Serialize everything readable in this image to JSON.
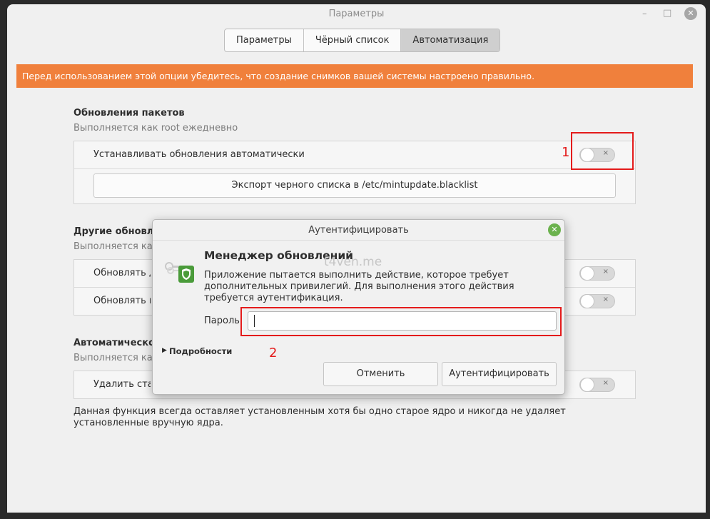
{
  "window": {
    "title": "Параметры",
    "controls": {
      "minimize": "–",
      "maximize": "□",
      "close": "✕"
    }
  },
  "tabs": [
    {
      "label": "Параметры",
      "active": false
    },
    {
      "label": "Чёрный список",
      "active": false
    },
    {
      "label": "Автоматизация",
      "active": true
    }
  ],
  "warning": "Перед использованием этой опции убедитесь, что создание снимков вашей системы настроено правильно.",
  "sections": {
    "packages": {
      "title": "Обновления пакетов",
      "subtitle": "Выполняется как root ежедневно",
      "auto_update_label": "Устанавливать обновления автоматически",
      "auto_update_on": false,
      "export_button": "Экспорт черного списка в /etc/mintupdate.blacklist"
    },
    "other": {
      "title": "Другие обновления",
      "subtitle": "Выполняется как root при загрузке",
      "rows": [
        {
          "label": "Обновлять драйверы",
          "on": false
        },
        {
          "label": "Обновлять пакеты",
          "on": false
        }
      ]
    },
    "autoremove": {
      "title": "Автоматическое удаление",
      "subtitle": "Выполняется как root",
      "row_label": "Удалить старые ядра",
      "on": false,
      "note": "Данная функция всегда оставляет установленным хотя бы одно старое ядро и никогда не удаляет установленные вручную ядра."
    }
  },
  "toggle_off_glyph": "×",
  "annotations": {
    "marker1": "1",
    "marker2": "2",
    "color": "#e41b1b"
  },
  "dialog": {
    "title": "Аутентифицировать",
    "close_glyph": "✕",
    "heading": "Менеджер обновлений",
    "watermark": "t4ven.me",
    "message": "Приложение пытается выполнить действие, которое требует дополнительных привилегий. Для выполнения этого действия требуется аутентификация.",
    "password_label": "Пароль:",
    "password_value": "",
    "details_label": "Подробности",
    "details_arrow": "▶",
    "cancel_button": "Отменить",
    "auth_button": "Аутентифицировать"
  },
  "colors": {
    "warning": "#f0803c",
    "dialog_close": "#6bb24d",
    "active_tab": "#cfcfcf"
  }
}
